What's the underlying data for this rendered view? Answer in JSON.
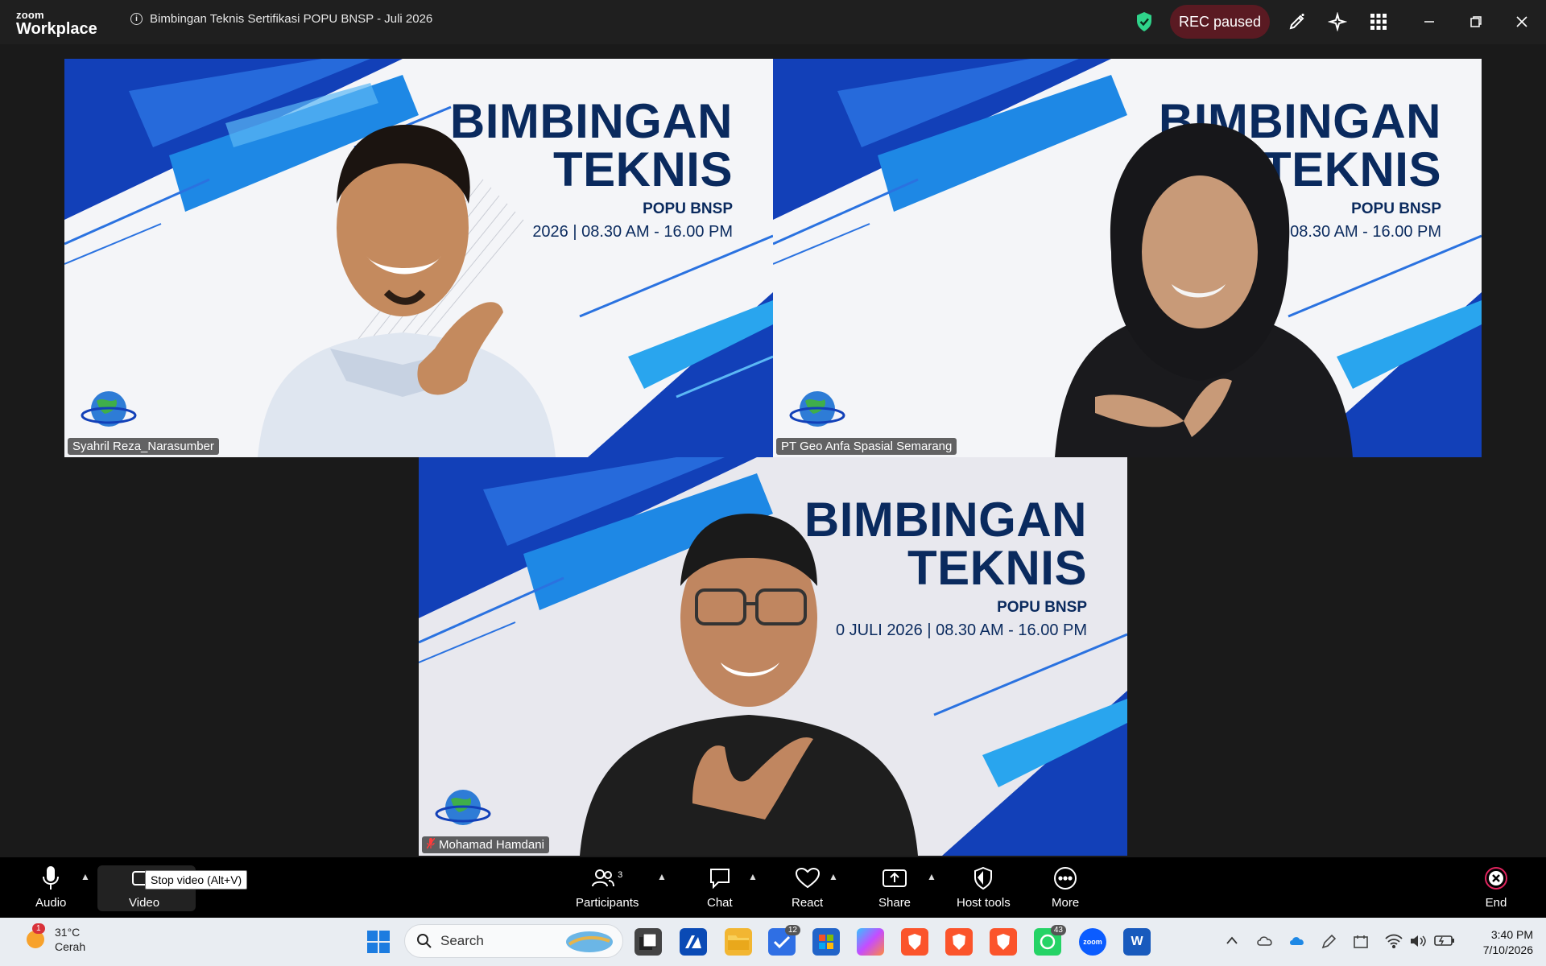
{
  "app": {
    "brand_small": "zoom",
    "brand_large": "Workplace",
    "meeting_title": "Bimbingan Teknis Sertifikasi POPU BNSP - Juli 2026",
    "rec_label": "REC paused"
  },
  "slide": {
    "line1": "BIMBINGAN",
    "line2": "TEKNIS",
    "line3": "POPU BNSP",
    "line4_a": "2026 | 08.30 AM - 16.00 PM",
    "line4_b": "026 | 08.30 AM - 16.00 PM",
    "line4_c": "0 JULI 2026 | 08.30 AM - 16.00 PM"
  },
  "participants_tiles": [
    {
      "name": "Syahril Reza_Narasumber"
    },
    {
      "name": "PT Geo Anfa Spasial Semarang"
    },
    {
      "name": "Mohamad Hamdani"
    }
  ],
  "toolbar": {
    "audio": "Audio",
    "video": "Video",
    "video_tooltip": "Stop video (Alt+V)",
    "participants": "Participants",
    "participants_count": "3",
    "chat": "Chat",
    "react": "React",
    "share": "Share",
    "host_tools": "Host tools",
    "more": "More",
    "end": "End"
  },
  "taskbar": {
    "weather_temp": "31°C",
    "weather_desc": "Cerah",
    "weather_badge": "1",
    "search_placeholder": "Search",
    "todo_badge": "12",
    "whatsapp_badge": "43",
    "zoom_label": "zoom",
    "word_label": "W",
    "time": "3:40 PM",
    "date": "7/10/2026"
  },
  "colors": {
    "active_speaker_border": "#2fd38a",
    "rec_bg": "#5a1a22",
    "slide_navy": "#0a2a5e",
    "slide_blue": "#1240b8"
  }
}
